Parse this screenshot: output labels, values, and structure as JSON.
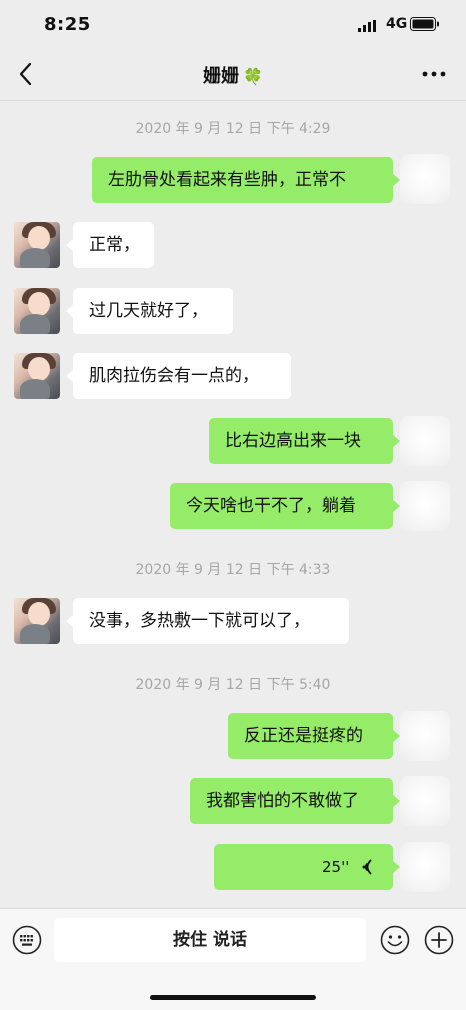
{
  "status_bar": {
    "time": "8:25",
    "network": "4G"
  },
  "nav": {
    "title": "姗姗",
    "title_emoji": "🍀"
  },
  "messages": [
    {
      "kind": "timestamp",
      "text": "2020 年 9 月 12 日 下午 4:29"
    },
    {
      "kind": "outgoing",
      "text": "左肋骨处看起来有些肿，正常不"
    },
    {
      "kind": "incoming",
      "text": "正常，"
    },
    {
      "kind": "incoming",
      "text": "过几天就好了，"
    },
    {
      "kind": "incoming",
      "text": "肌肉拉伤会有一点的，"
    },
    {
      "kind": "outgoing",
      "text": "比右边高出来一块"
    },
    {
      "kind": "outgoing",
      "text": "今天啥也干不了，躺着"
    },
    {
      "kind": "timestamp",
      "text": "2020 年 9 月 12 日 下午 4:33"
    },
    {
      "kind": "incoming",
      "text": "没事，多热敷一下就可以了，"
    },
    {
      "kind": "timestamp",
      "text": "2020 年 9 月 12 日 下午 5:40"
    },
    {
      "kind": "outgoing",
      "text": "反正还是挺疼的"
    },
    {
      "kind": "outgoing",
      "text": "我都害怕的不敢做了"
    },
    {
      "kind": "outgoing-voice",
      "text": "25''"
    }
  ],
  "input_bar": {
    "hold_to_talk": "按住 说话"
  },
  "icons": {
    "back": "chevron-left-icon",
    "more": "more-dots-icon",
    "keyboard": "keyboard-icon",
    "emoji": "emoji-icon",
    "plus": "plus-icon",
    "voice": "voice-wave-icon"
  },
  "colors": {
    "outgoing_bubble": "#95ec69",
    "incoming_bubble": "#ffffff",
    "background": "#ededed"
  }
}
